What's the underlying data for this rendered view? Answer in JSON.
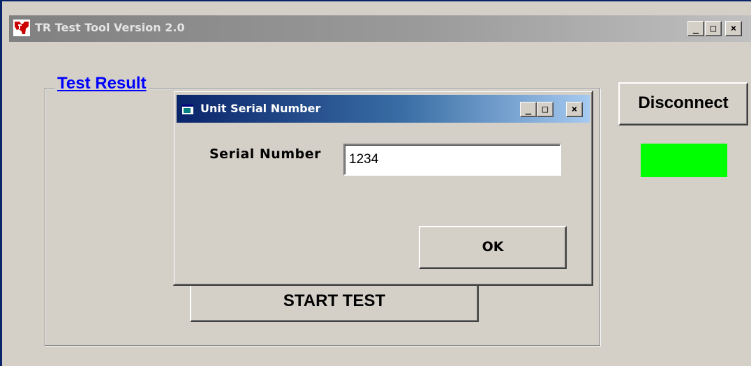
{
  "main_window": {
    "title": "TR Test Tool Version 2.0",
    "controls": {
      "minimize": "_",
      "maximize": "□",
      "close": "×"
    }
  },
  "test_result": {
    "legend": "Test Result",
    "start_button": "START TEST"
  },
  "connection": {
    "disconnect_button": "Disconnect",
    "status_color": "#00ff00"
  },
  "dialog": {
    "title": "Unit Serial Number",
    "controls": {
      "minimize": "_",
      "maximize": "□",
      "close": "×"
    },
    "serial_label": "Serial Number",
    "serial_value": "1234",
    "ok_button": "OK"
  },
  "icons": {
    "app": "texas-instruments-logo-icon",
    "dialog": "window-app-icon"
  },
  "colors": {
    "legend_link": "#0000ff",
    "dialog_titlebar": "#0a246a",
    "window_face": "#d4d0c8"
  }
}
